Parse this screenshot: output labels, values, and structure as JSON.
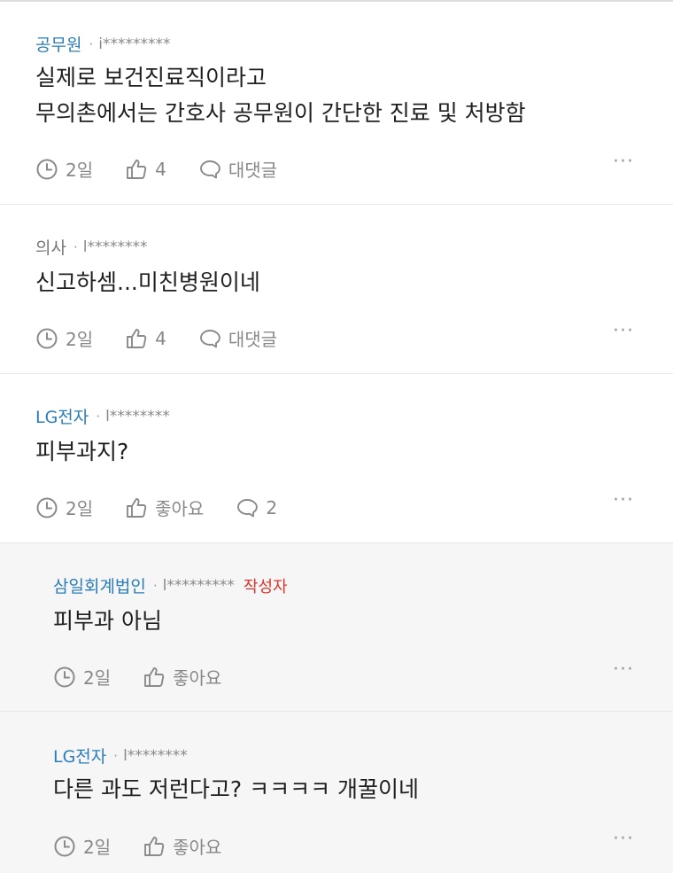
{
  "comments": [
    {
      "company": "공무원",
      "user_id": "i*********",
      "lines": [
        "실제로 보건진료직이라고",
        "무의촌에서는 간호사 공무원이 간단한 진료 및 처방함"
      ],
      "time": "2일",
      "likes": "4",
      "reply_label": "대댓글",
      "more": "···"
    },
    {
      "company": "의사",
      "user_id": "l********",
      "lines": [
        "신고하셈...미친병원이네"
      ],
      "time": "2일",
      "likes": "4",
      "reply_label": "대댓글",
      "more": "···"
    },
    {
      "company": "LG전자",
      "user_id": "l********",
      "lines": [
        "피부과지?"
      ],
      "time": "2일",
      "likes": "좋아요",
      "reply_label": "2",
      "more": "···"
    },
    {
      "company": "삼일회계법인",
      "user_id": "l*********",
      "author_badge": "작성자",
      "lines": [
        "피부과 아님"
      ],
      "time": "2일",
      "likes": "좋아요",
      "more": "···"
    },
    {
      "company": "LG전자",
      "user_id": "l********",
      "lines": [
        "다른 과도 저런다고? ㅋㅋㅋㅋ 개꿀이네"
      ],
      "time": "2일",
      "likes": "좋아요",
      "more": "···"
    }
  ]
}
